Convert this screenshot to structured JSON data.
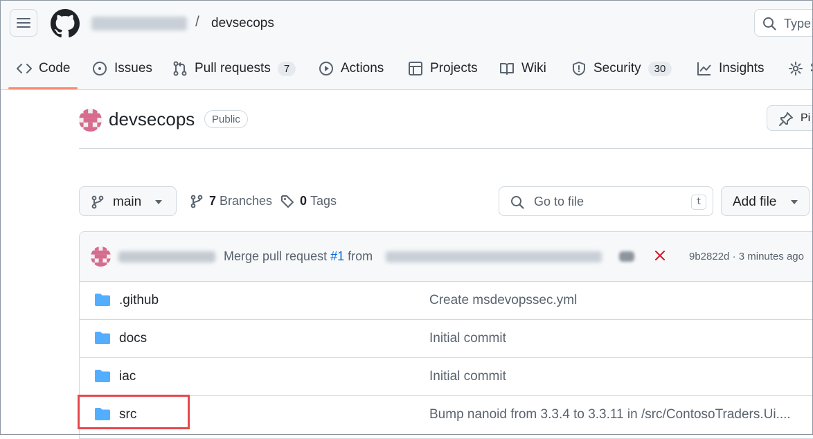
{
  "header": {
    "repo_name": "devsecops",
    "separator": "/",
    "search_placeholder": "Type"
  },
  "tabs": [
    {
      "label": "Code",
      "icon": "code-icon",
      "selected": true
    },
    {
      "label": "Issues",
      "icon": "issue-opened-icon"
    },
    {
      "label": "Pull requests",
      "icon": "git-pull-request-icon",
      "count": "7"
    },
    {
      "label": "Actions",
      "icon": "play-icon"
    },
    {
      "label": "Projects",
      "icon": "table-icon"
    },
    {
      "label": "Wiki",
      "icon": "book-icon"
    },
    {
      "label": "Security",
      "icon": "shield-icon",
      "count": "30"
    },
    {
      "label": "Insights",
      "icon": "graph-icon"
    },
    {
      "label": "S",
      "icon": "gear-icon"
    }
  ],
  "repo": {
    "title": "devsecops",
    "visibility": "Public",
    "pin_label": "Pi"
  },
  "toolbar": {
    "branch": "main",
    "branches_count": "7",
    "branches_label": "Branches",
    "tags_count": "0",
    "tags_label": "Tags",
    "goto_placeholder": "Go to file",
    "goto_shortcut": "t",
    "add_file_label": "Add file"
  },
  "latest_commit": {
    "message_prefix": "Merge pull request",
    "pr_number": "#1",
    "message_from": "from",
    "status": "failure",
    "hash": "9b2822d",
    "separator": "·",
    "time": "3 minutes ago"
  },
  "files": [
    {
      "name": ".github",
      "type": "folder",
      "message": "Create msdevopssec.yml"
    },
    {
      "name": "docs",
      "type": "folder",
      "message": "Initial commit"
    },
    {
      "name": "iac",
      "type": "folder",
      "message": "Initial commit"
    },
    {
      "name": "src",
      "type": "folder",
      "message": "Bump nanoid from 3.3.4 to 3.3.11 in /src/ContosoTraders.Ui...."
    }
  ],
  "colors": {
    "accent_underline": "#fd8c73",
    "link": "#0969da",
    "folder": "#54aeff",
    "error": "#d1242f",
    "highlight_box": "#e5484d"
  }
}
